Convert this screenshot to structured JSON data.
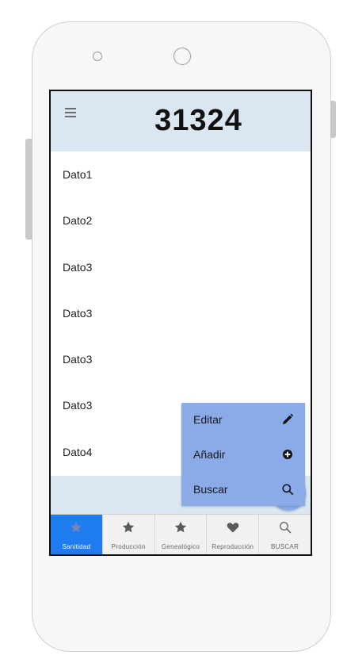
{
  "header": {
    "title": "31324"
  },
  "list": {
    "items": [
      {
        "label": "Dato1"
      },
      {
        "label": "Dato2"
      },
      {
        "label": "Dato3"
      },
      {
        "label": "Dato3"
      },
      {
        "label": "Dato3"
      },
      {
        "label": "Dato3"
      },
      {
        "label": "Dato4"
      }
    ]
  },
  "fab_menu": {
    "items": [
      {
        "label": "Editar",
        "icon": "pencil-icon"
      },
      {
        "label": "Añadir",
        "icon": "plus-circle-icon"
      },
      {
        "label": "Buscar",
        "icon": "search-icon"
      }
    ]
  },
  "bottom_nav": {
    "tabs": [
      {
        "label": "Sanitidad",
        "icon": "star-icon",
        "active": true
      },
      {
        "label": "Producción",
        "icon": "star-icon"
      },
      {
        "label": "Genealógico",
        "icon": "star-icon"
      },
      {
        "label": "Reproducción",
        "icon": "heart-icon"
      },
      {
        "label": "BUSCAR",
        "icon": "search-icon"
      }
    ]
  },
  "colors": {
    "header_bg": "#dbe6f3",
    "fab_menu_bg": "#8aaae8",
    "active_tab": "#1e7bf0"
  }
}
